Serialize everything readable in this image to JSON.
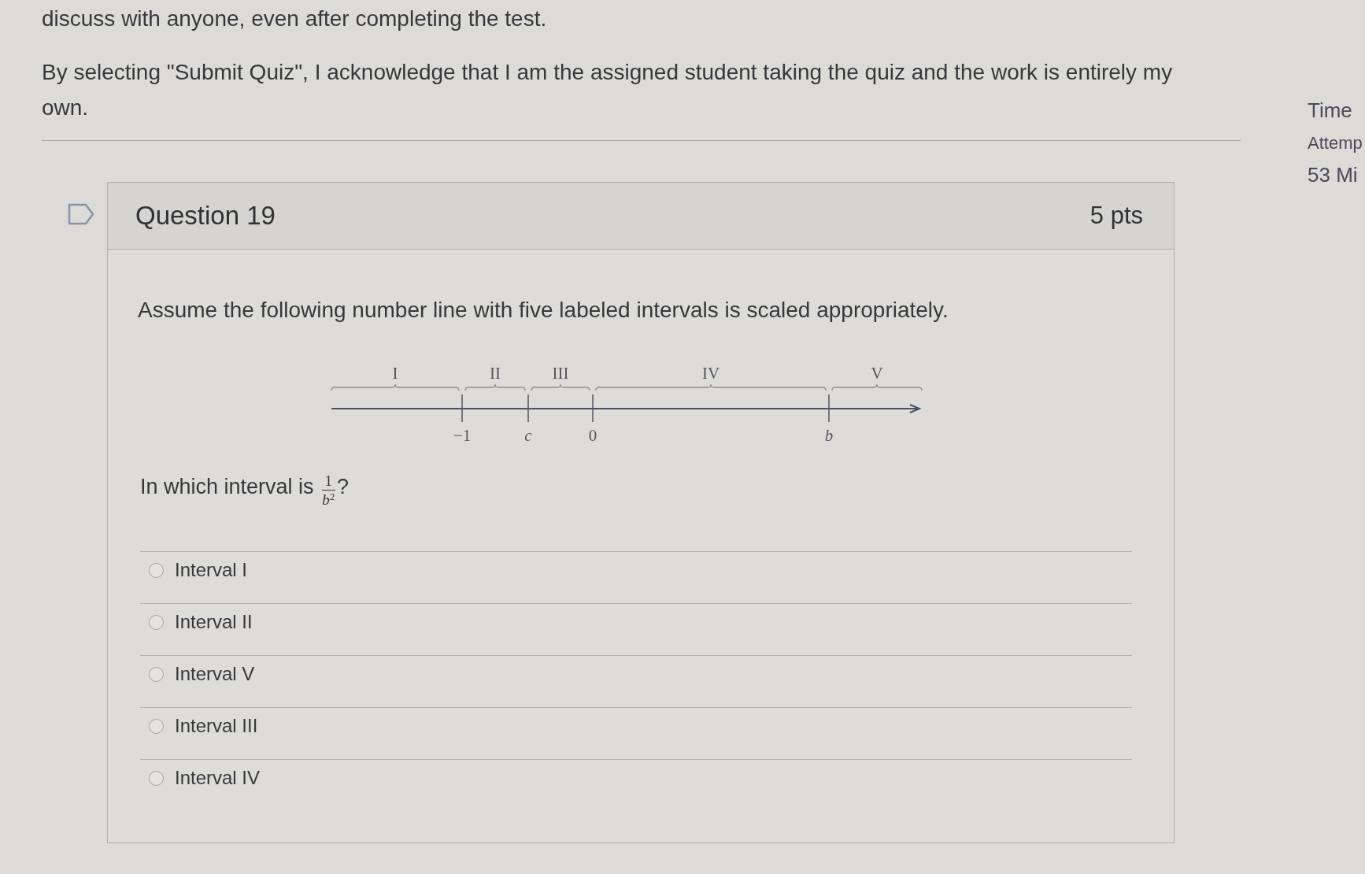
{
  "page": {
    "instruction_tail": "discuss with anyone, even after completing the test.",
    "acknowledgement": "By selecting \"Submit Quiz\", I acknowledge that I am the assigned student taking the quiz and the work is entirely my own."
  },
  "sidebar": {
    "time_label": "Time",
    "attempt_label": "Attemp",
    "time_value": "53 Mi"
  },
  "question": {
    "flagged": false,
    "title": "Question 19",
    "points": "5 pts",
    "text": "Assume the following number line with five labeled intervals is scaled appropriately.",
    "number_line": {
      "intervals": [
        {
          "label": "I"
        },
        {
          "label": "II"
        },
        {
          "label": "III"
        },
        {
          "label": "IV"
        },
        {
          "label": "V"
        }
      ],
      "ticks": [
        {
          "label": "−1",
          "kind": "number"
        },
        {
          "label": "c",
          "kind": "variable"
        },
        {
          "label": "0",
          "kind": "number"
        },
        {
          "label": "b",
          "kind": "variable"
        }
      ]
    },
    "prompt": {
      "text": "In which interval is",
      "numerator": "1",
      "denominator": "*b*$^{2}$",
      "end": "?"
    },
    "options": [
      {
        "label": "Interval I",
        "selected": false
      },
      {
        "label": "Interval II",
        "selected": false
      },
      {
        "label": "Interval V",
        "selected": false
      },
      {
        "label": "Interval III",
        "selected": false
      },
      {
        "label": "Interval IV",
        "selected": false
      }
    ]
  }
}
